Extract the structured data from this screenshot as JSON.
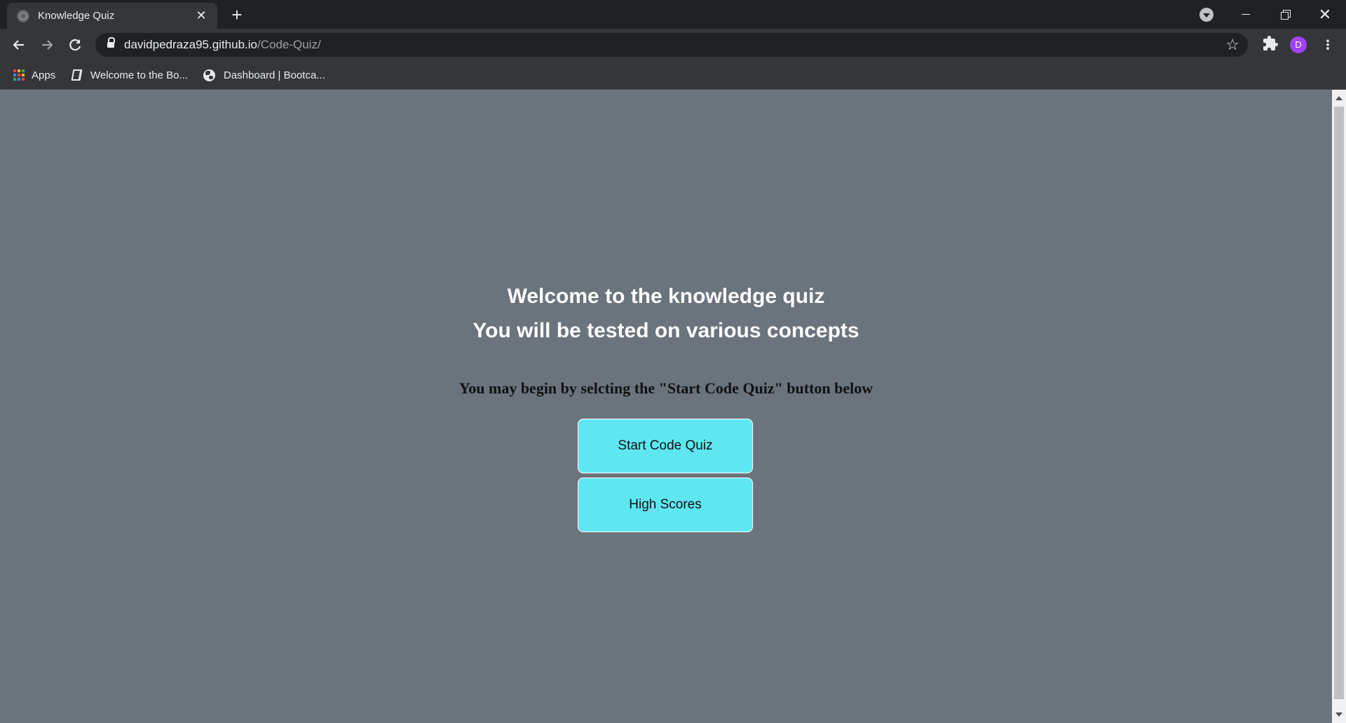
{
  "browser": {
    "tab": {
      "title": "Knowledge Quiz"
    },
    "new_tab_symbol": "+",
    "url": {
      "host": "davidpedraza95.github.io",
      "path": "/Code-Quiz/"
    },
    "profile_initial": "D",
    "bookmarks": [
      {
        "label": "Apps",
        "icon": "apps-grid-icon"
      },
      {
        "label": "Welcome to the Bo...",
        "icon": "book-icon"
      },
      {
        "label": "Dashboard | Bootca...",
        "icon": "globe-icon"
      }
    ],
    "accent_colors": {
      "avatar": "#a142f4",
      "chrome_dark": "#202124",
      "chrome_toolbar": "#35363a"
    }
  },
  "page": {
    "background": "#6b737c",
    "heading_line1": "Welcome to the knowledge quiz",
    "heading_line2": "You will be tested on various concepts",
    "instructions": "You may begin by selcting the \"Start Code Quiz\" button below",
    "buttons": {
      "start": "Start Code Quiz",
      "high_scores": "High Scores"
    },
    "button_color": "#5ee7f1"
  }
}
